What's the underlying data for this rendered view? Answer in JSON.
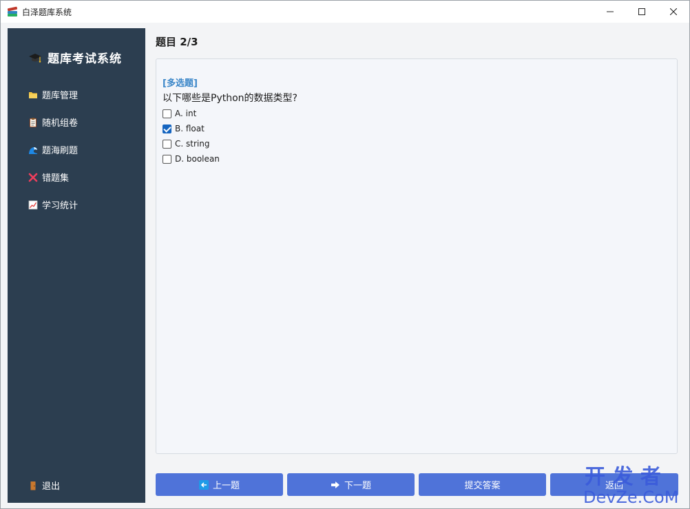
{
  "window": {
    "title": "白泽题库系统"
  },
  "sidebar": {
    "brand": "题库考试系统",
    "items": [
      {
        "label": "题库管理",
        "icon": "folder-icon"
      },
      {
        "label": "随机组卷",
        "icon": "clipboard-icon"
      },
      {
        "label": "题海刷题",
        "icon": "wave-icon"
      },
      {
        "label": "错题集",
        "icon": "cross-mark-icon"
      },
      {
        "label": "学习统计",
        "icon": "chart-icon"
      }
    ],
    "exit": {
      "label": "退出",
      "icon": "door-icon"
    }
  },
  "main": {
    "heading": "题目 2/3",
    "question": {
      "type": "[多选题]",
      "text": "以下哪些是Python的数据类型?",
      "options": [
        {
          "label": "A. int",
          "checked": false
        },
        {
          "label": "B. float",
          "checked": true
        },
        {
          "label": "C. string",
          "checked": false
        },
        {
          "label": "D. boolean",
          "checked": false
        }
      ]
    },
    "buttons": {
      "prev": "上一题",
      "next": "下一题",
      "submit": "提交答案",
      "back": "返回"
    }
  },
  "watermark": {
    "line1": "开 发 者",
    "line2": "DevZe.CoM"
  },
  "colors": {
    "sidebar": "#2c3e50",
    "button": "#4f73d9",
    "accent": "#3a86c8",
    "checkbox": "#1565c0"
  }
}
